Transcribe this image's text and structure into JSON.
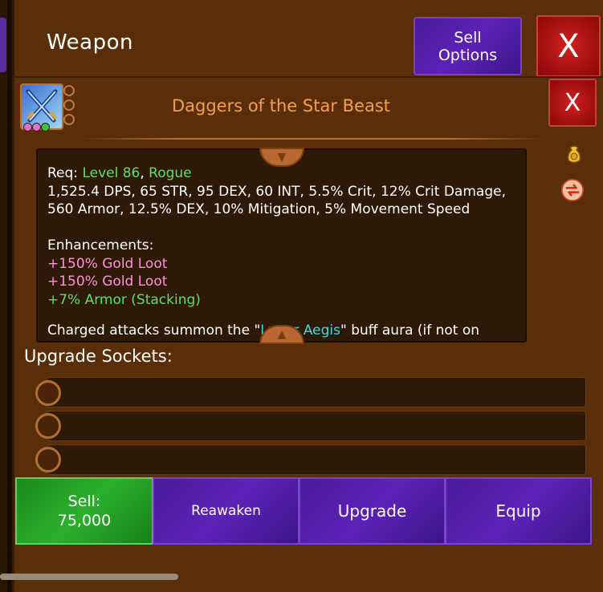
{
  "header": {
    "title": "Weapon",
    "sell_options": [
      "Sell",
      "Options"
    ],
    "close": "X"
  },
  "item": {
    "name": "Daggers of the Star Beast",
    "close": "X",
    "icon": "crossed-daggers-icon",
    "gem_colors": [
      "#e070d0",
      "#e070d0",
      "#40c040"
    ]
  },
  "description": {
    "req_label": "Req:",
    "req_level": "Level 86",
    "req_sep": ",",
    "req_class": "Rogue",
    "stats_line1": "1,525.4 DPS, 65 STR, 95 DEX, 60 INT, 5.5% Crit, 12% Crit Damage,",
    "stats_line2": "560 Armor, 12.5% DEX, 10% Mitigation, 5% Movement Speed",
    "enhancements_label": "Enhancements:",
    "enhancements": [
      {
        "text": "+150% Gold Loot",
        "color": "pink"
      },
      {
        "text": "+150% Gold Loot",
        "color": "pink"
      },
      {
        "text": "+7% Armor (Stacking)",
        "color": "green"
      }
    ],
    "cut_line_a": "Charged attacks summon the \"",
    "cut_line_b": "Lunar Aegis",
    "cut_line_c": "\" buff aura (if not on"
  },
  "upgrade_sockets": {
    "label": "Upgrade Sockets:",
    "slots": 3
  },
  "actions": {
    "sell_label": "Sell:",
    "sell_price": "75,000",
    "reawaken": "Reawaken",
    "upgrade": "Upgrade",
    "equip": "Equip"
  },
  "colors": {
    "title_orange": "#f0a050",
    "req_green": "#5ee05e",
    "enh_pink": "#ff8fe0",
    "button_purple": "#5d22b8",
    "button_green": "#2cb02c",
    "close_red": "#d02020"
  }
}
